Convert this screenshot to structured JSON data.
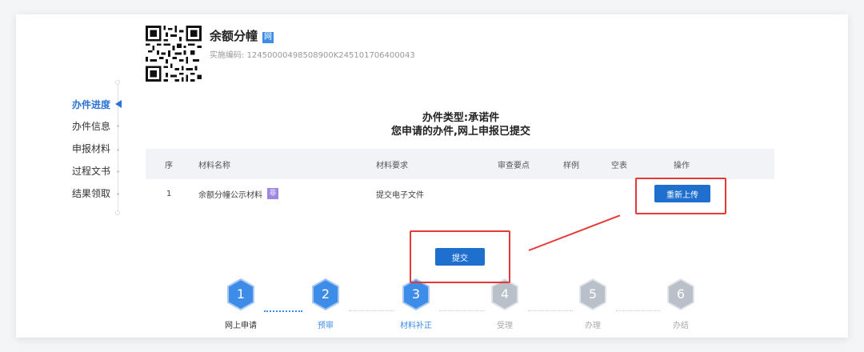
{
  "service": {
    "name": "余额分幢",
    "net_badge": "网",
    "code_label": "实施编码:",
    "code_value": "124500004985089​00K245101706400043"
  },
  "sidebar": {
    "items": [
      {
        "label": "办件进度",
        "active": true
      },
      {
        "label": "办件信息",
        "active": false
      },
      {
        "label": "申报材料",
        "active": false
      },
      {
        "label": "过程文书",
        "active": false
      },
      {
        "label": "结果领取",
        "active": false
      }
    ]
  },
  "main": {
    "type_title": "办件类型:承诺件",
    "status_text": "您申请的办件,网上申报已提交"
  },
  "table": {
    "headers": [
      "序",
      "材料名称",
      "材料要求",
      "审查要点",
      "样例",
      "空表",
      "操作"
    ],
    "rows": [
      {
        "index": "1",
        "name": "余额分幢公示材料",
        "badge": "非",
        "requirement": "提交电子文件",
        "action": "重新上传"
      }
    ]
  },
  "submit_label": "提交",
  "steps": [
    {
      "num": "1",
      "label": "网上申请",
      "state": "done"
    },
    {
      "num": "2",
      "label": "预审",
      "state": "active"
    },
    {
      "num": "3",
      "label": "材料补正",
      "state": "active"
    },
    {
      "num": "4",
      "label": "受理",
      "state": "pending"
    },
    {
      "num": "5",
      "label": "办理",
      "state": "pending"
    },
    {
      "num": "6",
      "label": "办结",
      "state": "pending"
    }
  ],
  "colors": {
    "accent": "#1e6fce",
    "hex_active": "#3d8de8",
    "hex_pending": "#b9c0c9",
    "annotation": "#e53935"
  }
}
